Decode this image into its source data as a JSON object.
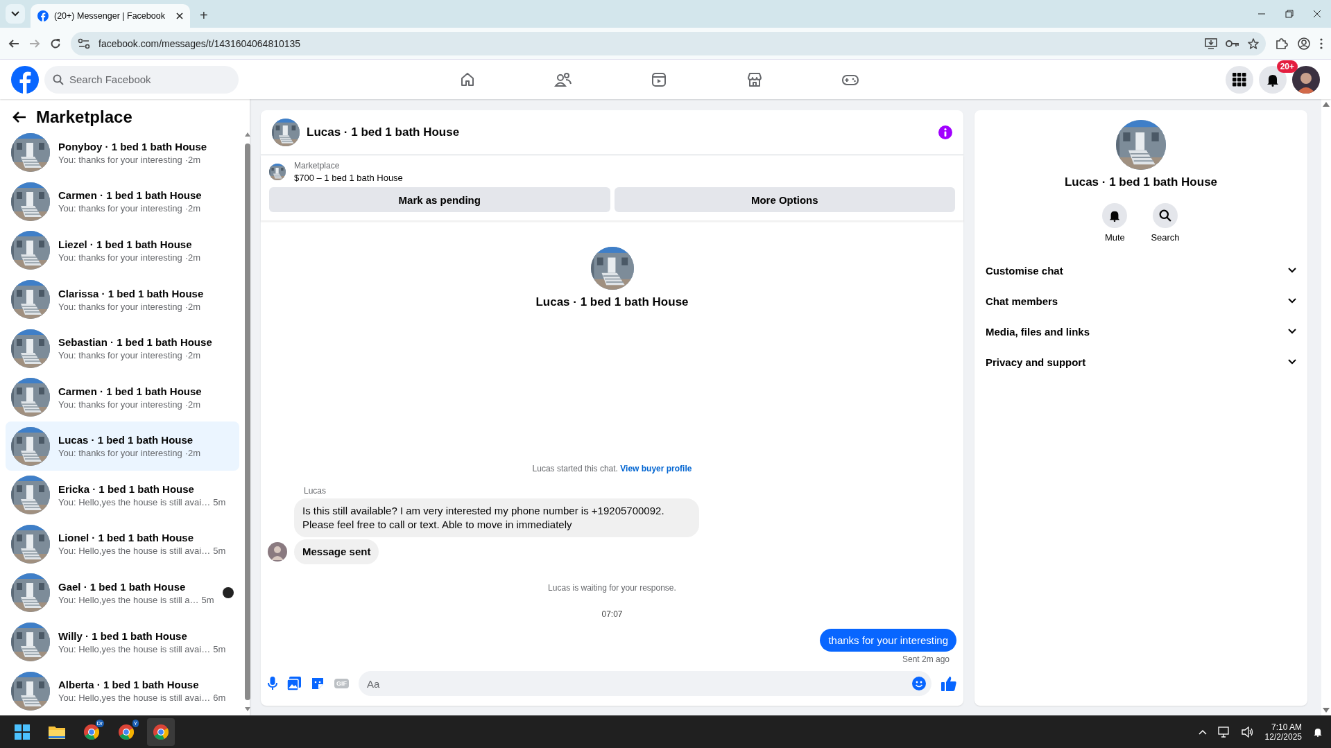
{
  "browser": {
    "tab_title": "(20+) Messenger | Facebook",
    "new_tab": "+",
    "url": "facebook.com/messages/t/1431604064810135"
  },
  "header": {
    "search_placeholder": "Search Facebook",
    "nav": [
      {
        "kind": "home"
      },
      {
        "kind": "friends"
      },
      {
        "kind": "video"
      },
      {
        "kind": "store"
      },
      {
        "kind": "games"
      }
    ],
    "notification_badge": "20+"
  },
  "sidebar": {
    "title": "Marketplace",
    "conversations": [
      {
        "name": "Ponyboy · 1 bed 1 bath House",
        "preview": "You: thanks for your interesting",
        "time": "·2m",
        "selected": false,
        "seen": false
      },
      {
        "name": "Carmen · 1 bed 1 bath House",
        "preview": "You: thanks for your interesting",
        "time": "·2m",
        "selected": false,
        "seen": false
      },
      {
        "name": "Liezel · 1 bed 1 bath House",
        "preview": "You: thanks for your interesting",
        "time": "·2m",
        "selected": false,
        "seen": false
      },
      {
        "name": "Clarissa · 1 bed 1 bath House",
        "preview": "You: thanks for your interesting",
        "time": "·2m",
        "selected": false,
        "seen": false
      },
      {
        "name": "Sebastian · 1 bed 1 bath House",
        "preview": "You: thanks for your interesting",
        "time": "·2m",
        "selected": false,
        "seen": false
      },
      {
        "name": "Carmen · 1 bed 1 bath House",
        "preview": "You: thanks for your interesting",
        "time": "·2m",
        "selected": false,
        "seen": false
      },
      {
        "name": "Lucas · 1 bed 1 bath House",
        "preview": "You: thanks for your interesting",
        "time": "·2m",
        "selected": true,
        "seen": false
      },
      {
        "name": "Ericka · 1 bed 1 bath House",
        "preview": "You: Hello,yes the house is still avai…",
        "time": "5m",
        "selected": false,
        "seen": false
      },
      {
        "name": "Lionel · 1 bed 1 bath House",
        "preview": "You: Hello,yes the house is still avai…",
        "time": "5m",
        "selected": false,
        "seen": false
      },
      {
        "name": "Gael · 1 bed 1 bath House",
        "preview": "You: Hello,yes the house is still a…",
        "time": "5m",
        "selected": false,
        "seen": true
      },
      {
        "name": "Willy · 1 bed 1 bath House",
        "preview": "You: Hello,yes the house is still avai…",
        "time": "5m",
        "selected": false,
        "seen": false
      },
      {
        "name": "Alberta · 1 bed 1 bath House",
        "preview": "You: Hello,yes the house is still avai…",
        "time": "6m",
        "selected": false,
        "seen": false
      }
    ]
  },
  "chat": {
    "title": "Lucas · 1 bed 1 bath House",
    "listing": {
      "source": "Marketplace",
      "title": "$700 – 1 bed 1 bath House"
    },
    "buttons": [
      "Mark as pending",
      "More Options"
    ],
    "intro_name": "Lucas · 1 bed 1 bath House",
    "started_text": "Lucas started this chat.",
    "profile_link": "View buyer profile",
    "sender": "Lucas",
    "messages": [
      {
        "kind": "incoming",
        "text": "Is this still available? I am very interested my phone number is +19205700092. Please feel free to call or text. Able to move in immediately"
      },
      {
        "kind": "notice",
        "text": "Message sent"
      }
    ],
    "waiting_text": "Lucas is waiting for your response.",
    "timestamp": "07:07",
    "outgoing": {
      "text": "thanks for your interesting",
      "status": "Sent 2m ago"
    },
    "composer": {
      "placeholder": "Aa",
      "gif_label": "GIF"
    }
  },
  "details": {
    "name": "Lucas · 1 bed 1 bath House",
    "actions": [
      {
        "kind": "mute",
        "label": "Mute"
      },
      {
        "kind": "search",
        "label": "Search"
      }
    ],
    "sections": [
      {
        "label": "Customise chat",
        "expanded": false
      },
      {
        "label": "Chat members",
        "expanded": false
      },
      {
        "label": "Media, files and links",
        "expanded": false
      },
      {
        "label": "Privacy and support",
        "expanded": false
      }
    ]
  },
  "taskbar": {
    "apps": [
      {
        "kind": "start",
        "selected": false
      },
      {
        "kind": "files",
        "selected": false
      },
      {
        "kind": "chrome",
        "badge": "Dr",
        "selected": false
      },
      {
        "kind": "chrome",
        "badge": "Y",
        "selected": false
      },
      {
        "kind": "chrome",
        "selected": true
      }
    ],
    "time": "7:10 AM",
    "date": "12/2/2025"
  }
}
